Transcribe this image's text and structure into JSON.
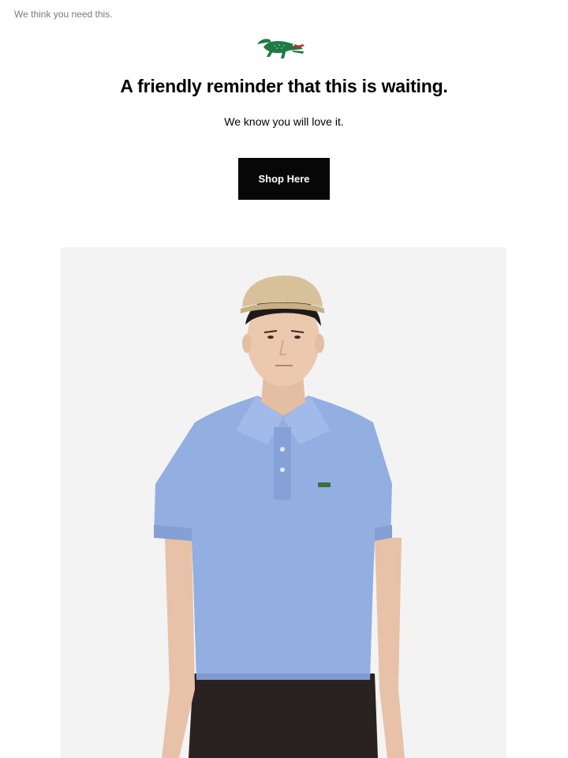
{
  "email": {
    "preheader": "We think you need this.",
    "brand_icon": "crocodile-logo-icon",
    "headline": "A friendly reminder that this is waiting.",
    "subheadline": "We know you will love it.",
    "cta_label": "Shop Here",
    "hero_image": "model-in-light-blue-polo-shirt-and-beige-cap"
  },
  "colors": {
    "background": "#ffffff",
    "cta_background": "#070707",
    "cta_text": "#ffffff",
    "logo_green": "#1d7a45",
    "polo_blue": "#93aee0",
    "hero_background": "#f3f3f3"
  }
}
